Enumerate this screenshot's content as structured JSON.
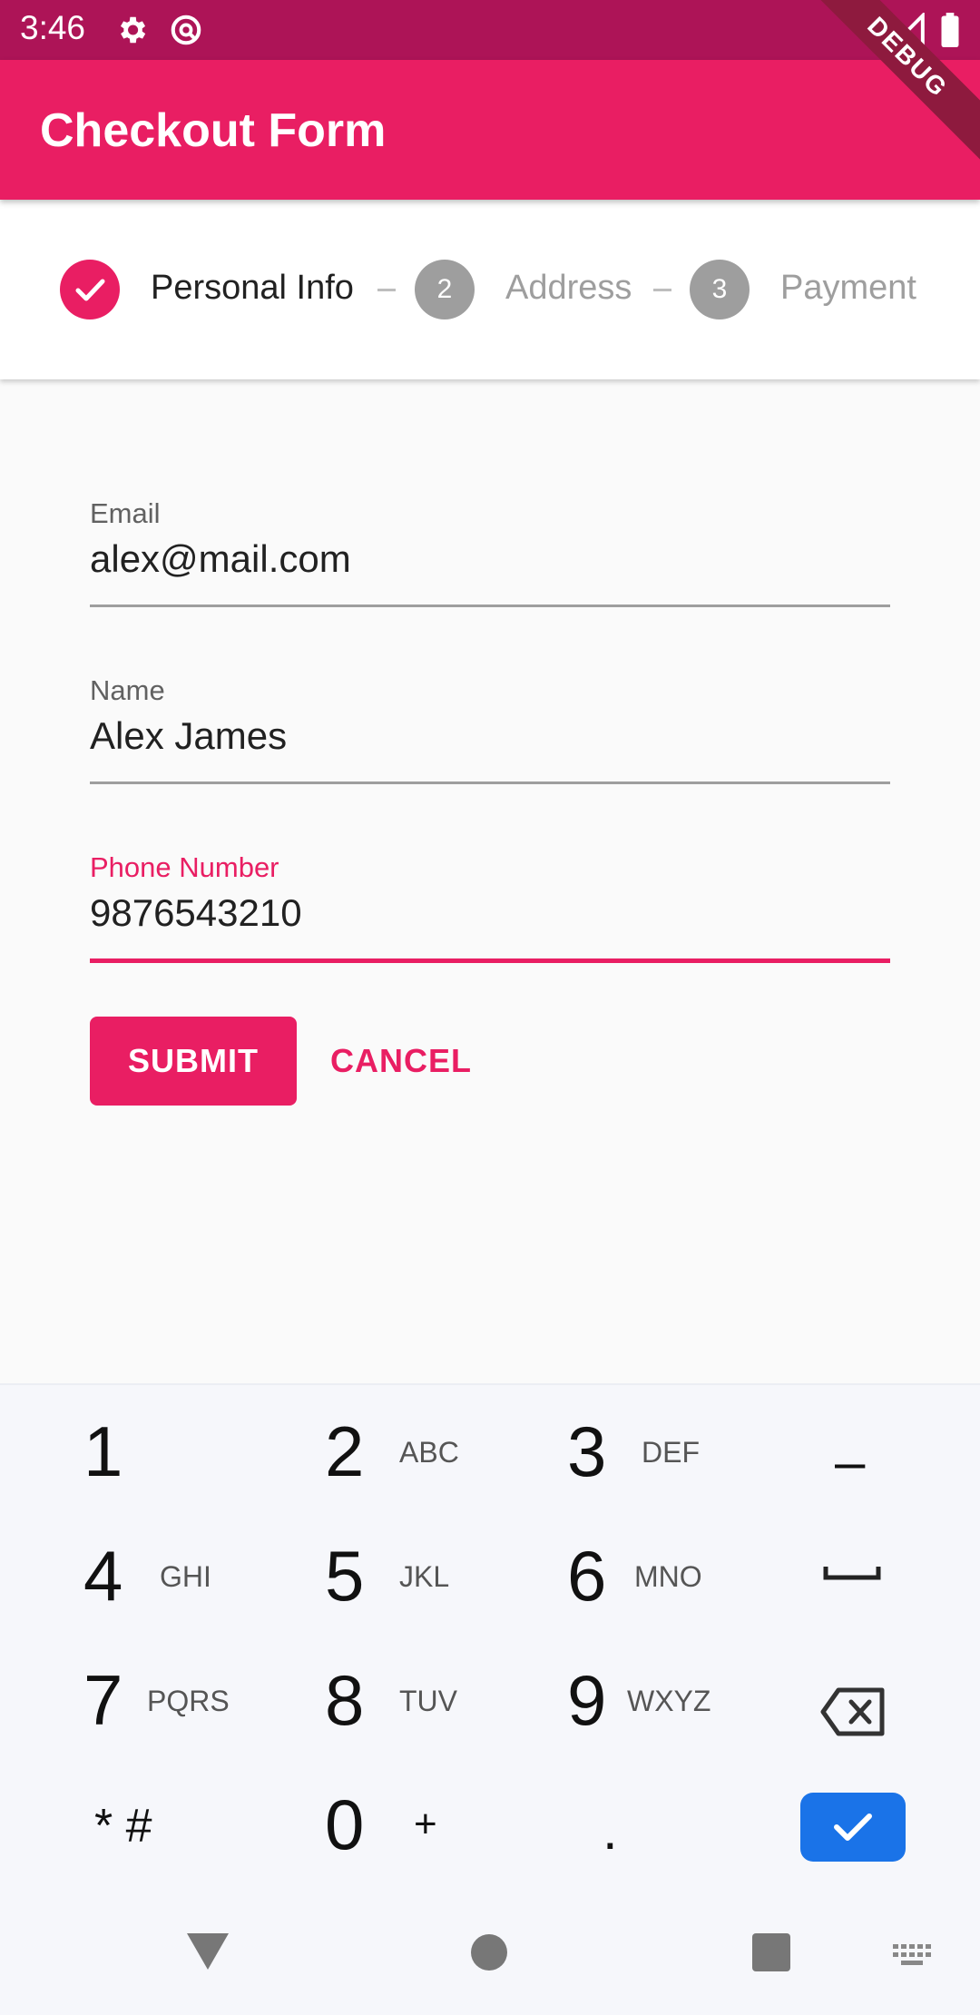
{
  "status_bar": {
    "time": "3:46",
    "debug_label": "DEBUG"
  },
  "app_bar": {
    "title": "Checkout Form"
  },
  "stepper": {
    "steps": [
      {
        "number": "1",
        "label": "Personal Info",
        "state": "complete"
      },
      {
        "number": "2",
        "label": "Address",
        "state": "inactive"
      },
      {
        "number": "3",
        "label": "Payment",
        "state": "inactive"
      }
    ]
  },
  "form": {
    "email": {
      "label": "Email",
      "value": "alex@mail.com"
    },
    "name": {
      "label": "Name",
      "value": "Alex James"
    },
    "phone": {
      "label": "Phone Number",
      "value": "9876543210"
    },
    "submit_label": "SUBMIT",
    "cancel_label": "CANCEL"
  },
  "keyboard": {
    "keys": [
      {
        "digit": "1",
        "letters": ""
      },
      {
        "digit": "2",
        "letters": "ABC"
      },
      {
        "digit": "3",
        "letters": "DEF"
      },
      {
        "digit": "4",
        "letters": "GHI"
      },
      {
        "digit": "5",
        "letters": "JKL"
      },
      {
        "digit": "6",
        "letters": "MNO"
      },
      {
        "digit": "7",
        "letters": "PQRS"
      },
      {
        "digit": "8",
        "letters": "TUV"
      },
      {
        "digit": "9",
        "letters": "WXYZ"
      },
      {
        "digit": "0",
        "letters": "+"
      }
    ],
    "star_hash": "* #",
    "period": ".",
    "minus": "–"
  },
  "colors": {
    "primary": "#e91e63",
    "status_bar": "#ad1457",
    "done_key": "#1a73e8"
  }
}
